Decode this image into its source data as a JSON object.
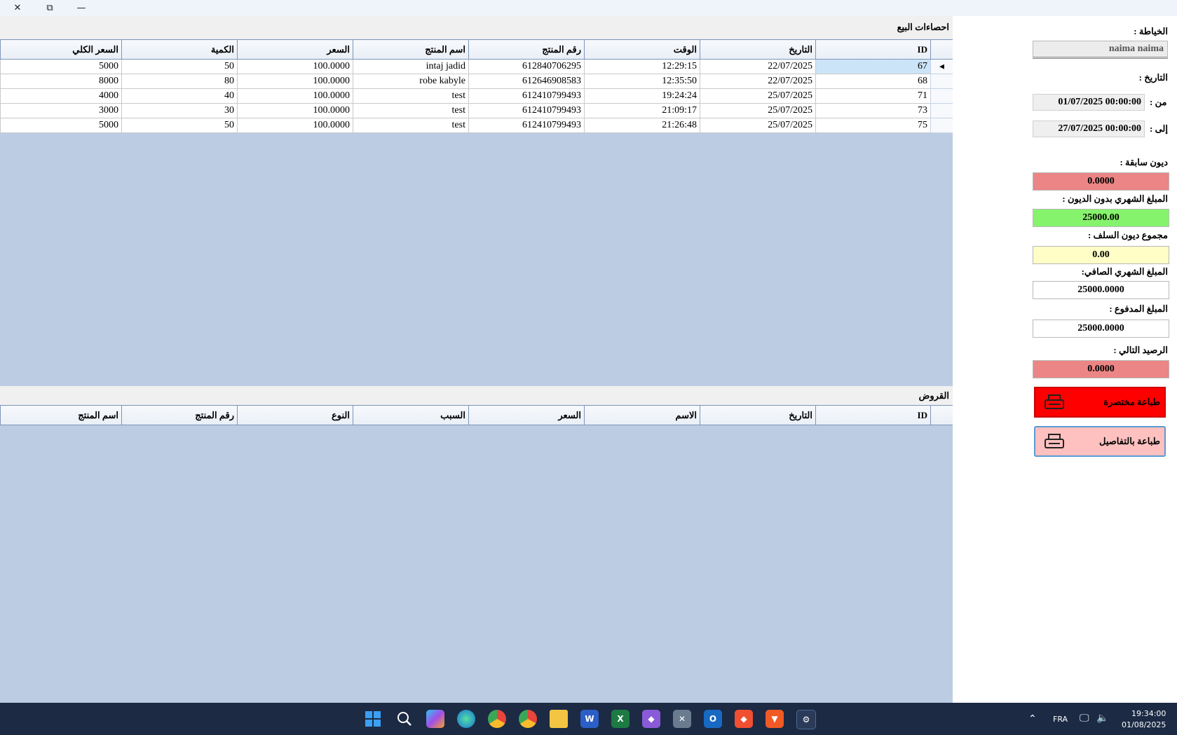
{
  "sales": {
    "title": "احصاءات البيع",
    "columns": [
      "ID",
      "التاريخ",
      "الوقت",
      "رقم المنتج",
      "اسم المنتج",
      "السعر",
      "الكمية",
      "السعر الكلي"
    ],
    "rows": [
      [
        "67",
        "22/07/2025",
        "12:29:15",
        "612840706295",
        "intaj jadid",
        "100.0000",
        "50",
        "5000"
      ],
      [
        "68",
        "22/07/2025",
        "12:35:50",
        "612646908583",
        "robe kabyle",
        "100.0000",
        "80",
        "8000"
      ],
      [
        "71",
        "25/07/2025",
        "19:24:24",
        "612410799493",
        "test",
        "100.0000",
        "40",
        "4000"
      ],
      [
        "73",
        "25/07/2025",
        "21:09:17",
        "612410799493",
        "test",
        "100.0000",
        "30",
        "3000"
      ],
      [
        "75",
        "25/07/2025",
        "21:26:48",
        "612410799493",
        "test",
        "100.0000",
        "50",
        "5000"
      ]
    ]
  },
  "loans": {
    "title": "القروض",
    "columns": [
      "ID",
      "التاريخ",
      "الاسم",
      "السعر",
      "السبب",
      "النوع",
      "رقم المنتج",
      "اسم المنتج"
    ]
  },
  "panel": {
    "tailor_label": "الخياطة :",
    "tailor_value": "naima naima",
    "date_label": "التاريخ :",
    "from_label": "من :",
    "from_value": "01/07/2025 00:00:00",
    "to_label": "إلى :",
    "to_value": "27/07/2025 00:00:00",
    "prev_debts_label": "ديون سابقة :",
    "prev_debts_value": "0.0000",
    "monthly_no_debt_label": "المبلغ الشهري بدون الديون :",
    "monthly_no_debt_value": "25000.00",
    "advances_label": "مجموع ديون السلف :",
    "advances_value": "0.00",
    "net_monthly_label": "المبلغ الشهري الصافي:",
    "net_monthly_value": "25000.0000",
    "paid_label": "المبلغ المدفوع :",
    "paid_value": "25000.0000",
    "balance_label": "الرصيد التالي :",
    "balance_value": "0.0000",
    "print_short": "طباعة مختصرة",
    "print_detail": "طباعة بالتفاصيل"
  },
  "taskbar": {
    "lang": "FRA",
    "time": "19:34:00",
    "date": "01/08/2025"
  },
  "colors": {
    "grid_bg": "#bccce2",
    "red": "#ec8585",
    "green": "#86f36c",
    "yellow": "#fefec6",
    "print_short_bg": "#ff0000",
    "print_detail_bg": "#ffc0c0"
  }
}
